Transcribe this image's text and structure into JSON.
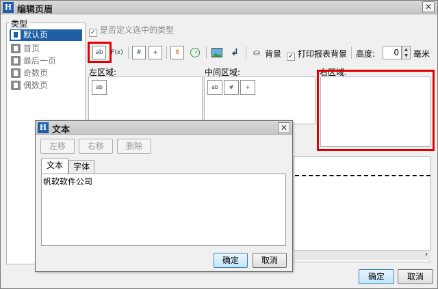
{
  "window": {
    "title": "编辑页眉",
    "close_glyph": "✕",
    "icon_letter": "H"
  },
  "type_panel": {
    "legend": "类型",
    "items": [
      {
        "label": "默认页",
        "selected": true
      },
      {
        "label": "首页",
        "selected": false
      },
      {
        "label": "最后一页",
        "selected": false
      },
      {
        "label": "奇数页",
        "selected": false
      },
      {
        "label": "偶数页",
        "selected": false
      }
    ]
  },
  "custom_type_check": {
    "label": "是否定义选中的类型",
    "checked": true
  },
  "toolbar": {
    "text_icon": "ab",
    "formula_icon": "F(x)",
    "page_number_icon": "#",
    "total_pages_icon": "+",
    "date_icon": "8",
    "background_label": "背景",
    "print_background_label": "打印报表背景",
    "print_background_checked": true,
    "height_label": "高度:",
    "height_value": "0",
    "unit": "毫米"
  },
  "areas": {
    "left_label": "左区域:",
    "middle_label": "中间区域:",
    "right_label": "右区域:"
  },
  "main_buttons": {
    "ok": "确定",
    "cancel": "取消"
  },
  "dialog": {
    "title": "文本",
    "close_glyph": "✕",
    "move_left": "左移",
    "move_right": "右移",
    "delete": "删除",
    "tabs": [
      {
        "label": "文本",
        "active": true
      },
      {
        "label": "字体",
        "active": false
      }
    ],
    "content": "帆软软件公司",
    "ok": "确定",
    "cancel": "取消"
  },
  "colors": {
    "highlight": "#e00000",
    "selection": "#1f5fa6"
  }
}
